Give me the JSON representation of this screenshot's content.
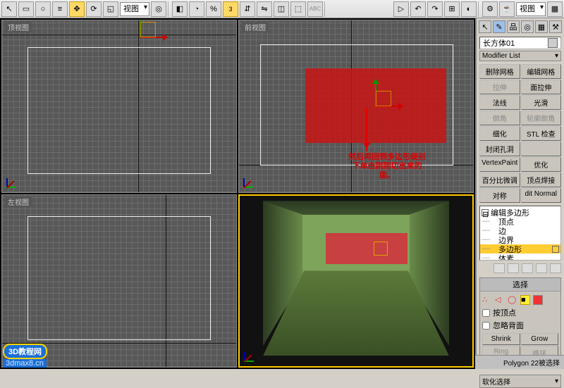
{
  "toolbar": {
    "sel_label_1": "视图",
    "sel_label_2": "视图"
  },
  "viewports": {
    "top": "顶视图",
    "front": "前视图",
    "left": "左视图",
    "persp": ""
  },
  "annotation": {
    "line1": "然后再回到多边形级别",
    "line2": "下单击刚刚切出来的",
    "line3": "面。"
  },
  "panel": {
    "object_name": "长方体01",
    "modifier_list": "Modifier List",
    "buttons": {
      "b1": "删除网格",
      "b2": "编辑网格",
      "b3": "拉伸",
      "b4": "面拉伸",
      "b5": "法线",
      "b6": "光滑",
      "b7": "倒角",
      "b8": "轮廓倒角",
      "b9": "细化",
      "b10": "STL 检查",
      "b11": "封闭孔洞",
      "b12": "",
      "b13": "VertexPaint",
      "b14": "优化",
      "b15": "百分比微调",
      "b16": "顶点焊接",
      "b17": "对称",
      "b18": "dit Normal"
    },
    "tree": {
      "root": "编辑多边形",
      "t1": "顶点",
      "t2": "边",
      "t3": "边界",
      "t4": "多边形",
      "t5": "体素"
    },
    "selection": {
      "head": "选择",
      "by_vertex": "按顶点",
      "ignore_back": "忽略背面",
      "shrink": "Shrink",
      "grow": "Grow",
      "ring": "Ring",
      "loop": "循环"
    },
    "softsel": "软化选择",
    "status": "Polygon 22被选择"
  },
  "watermark": {
    "badge": "3D教程网",
    "url": "3dmax8.cn"
  }
}
